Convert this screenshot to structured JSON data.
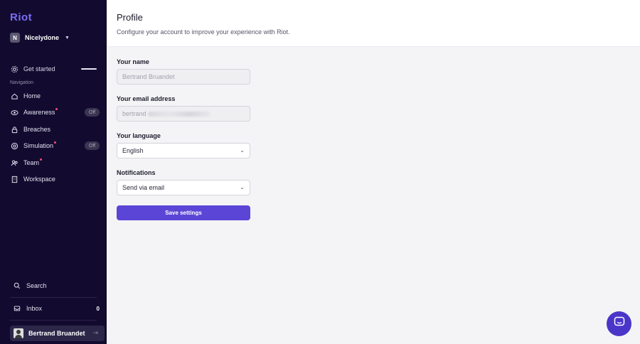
{
  "sidebar": {
    "logo": "Riot",
    "org": {
      "initial": "N",
      "name": "Nicelydone"
    },
    "get_started": "Get started",
    "nav_header": "Navigation",
    "items": [
      {
        "label": "Home",
        "icon": "home-icon"
      },
      {
        "label": "Awareness",
        "icon": "eye-icon",
        "badge": "Off"
      },
      {
        "label": "Breaches",
        "icon": "lock-icon"
      },
      {
        "label": "Simulation",
        "icon": "target-icon",
        "badge": "Off"
      },
      {
        "label": "Team",
        "icon": "team-icon"
      },
      {
        "label": "Workspace",
        "icon": "building-icon"
      }
    ],
    "search": "Search",
    "inbox": {
      "label": "Inbox",
      "count": "0"
    },
    "user": {
      "name": "Bertrand Bruandet"
    }
  },
  "header": {
    "title": "Profile",
    "subtitle": "Configure your account to improve your experience with Riot."
  },
  "form": {
    "name": {
      "label": "Your name",
      "value": "Bertrand Bruandet"
    },
    "email": {
      "label": "Your email address",
      "value": "bertrand"
    },
    "language": {
      "label": "Your language",
      "value": "English"
    },
    "notifications": {
      "label": "Notifications",
      "value": "Send via email"
    },
    "save_label": "Save settings"
  },
  "colors": {
    "sidebar_bg": "#120b2f",
    "accent": "#5b45d6",
    "dot": "#f0506e"
  }
}
